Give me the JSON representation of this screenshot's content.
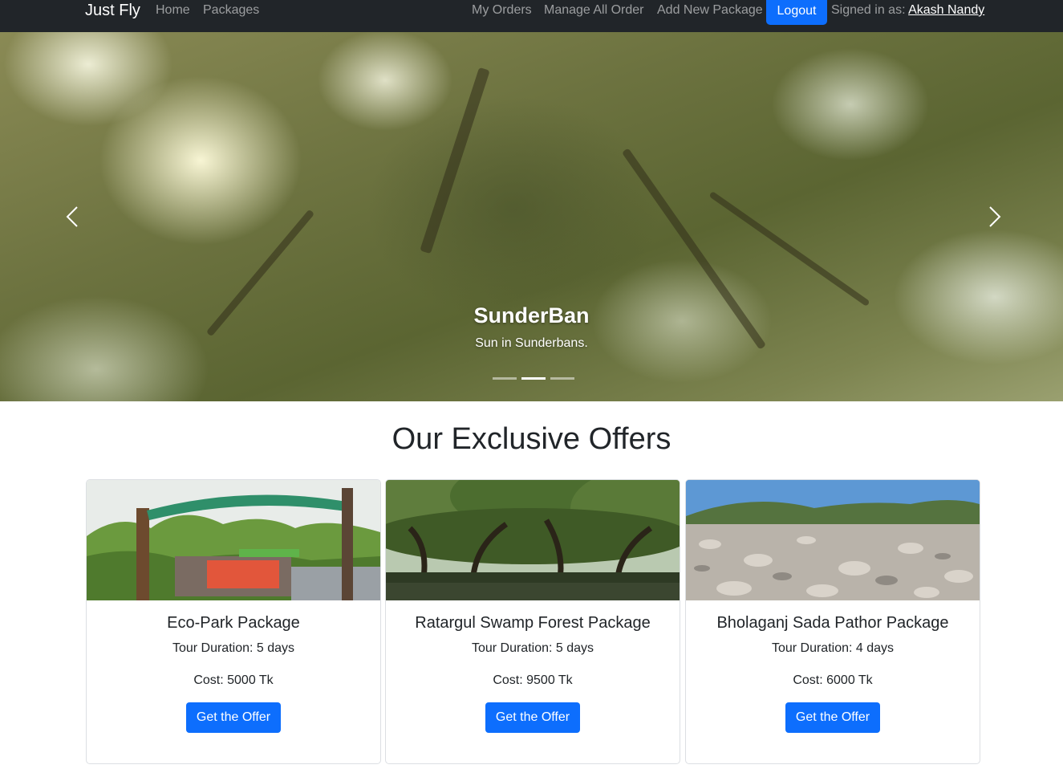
{
  "navbar": {
    "brand": "Just Fly",
    "links": [
      "Home",
      "Packages"
    ],
    "right_links": [
      "My Orders",
      "Manage All Order",
      "Add New Package"
    ],
    "logout_label": "Logout",
    "signed_in_prefix": "Signed in as:",
    "user_name": "Akash Nandy"
  },
  "hero": {
    "title": "SunderBan",
    "subtitle": "Sun in Sunderbans.",
    "slide_count": 3,
    "active_slide": 2
  },
  "offers": {
    "heading": "Our Exclusive Offers",
    "cards": [
      {
        "title": "Eco-Park Package",
        "duration": "Tour Duration: 5 days",
        "cost": "Cost: 5000 Tk",
        "button": "Get the Offer"
      },
      {
        "title": "Ratargul Swamp Forest Package",
        "duration": "Tour Duration: 5 days",
        "cost": "Cost: 9500 Tk",
        "button": "Get the Offer"
      },
      {
        "title": "Bholaganj Sada Pathor Package",
        "duration": "Tour Duration: 4 days",
        "cost": "Cost: 6000 Tk",
        "button": "Get the Offer"
      }
    ]
  },
  "colors": {
    "navbar_bg": "#212529",
    "primary": "#0d6efd",
    "text": "#212529"
  }
}
